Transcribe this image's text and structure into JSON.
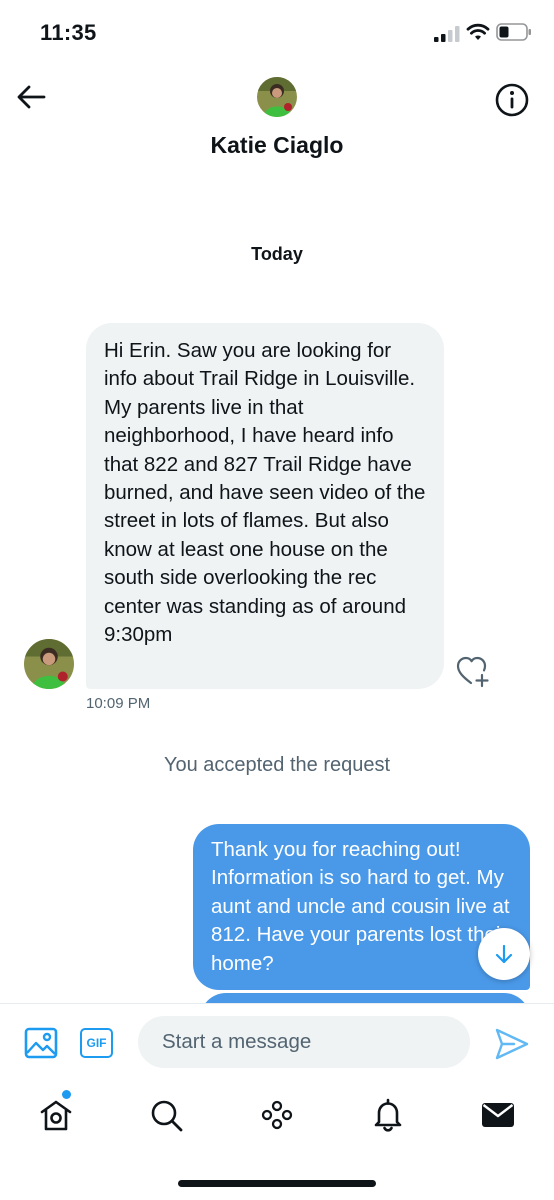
{
  "status_bar": {
    "time": "11:35"
  },
  "header": {
    "contact_name": "Katie Ciaglo"
  },
  "conversation": {
    "date_separator": "Today",
    "incoming_message": {
      "text": "Hi Erin. Saw you are looking for info about Trail Ridge in Louisville. My parents live in that neighborhood, I have heard info that 822 and 827 Trail Ridge have burned, and have seen video of the street in lots of flames. But also know at least one house on the south side overlooking the rec center was standing as of around 9:30pm",
      "timestamp": "10:09 PM"
    },
    "system_note": "You accepted the request",
    "outgoing_message": {
      "text": "Thank you for reaching out! Information is so hard to get. My aunt and uncle and cousin live at 812. Have your parents lost their home?"
    }
  },
  "composer": {
    "gif_label": "GIF",
    "placeholder": "Start a message"
  },
  "tabs": [
    "home",
    "search",
    "spaces",
    "notifications",
    "messages"
  ],
  "colors": {
    "accent": "#1d9bf0",
    "outgoing_bubble": "#4a99e9",
    "incoming_bubble": "#eff3f4",
    "secondary_text": "#536471"
  }
}
